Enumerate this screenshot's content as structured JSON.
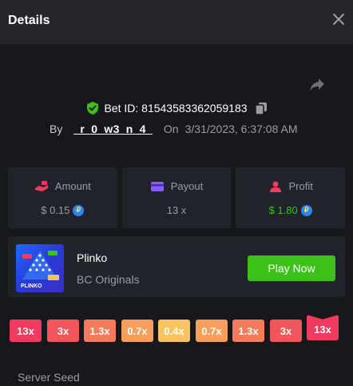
{
  "header": {
    "title": "Details"
  },
  "bet": {
    "id_text": "Bet ID: 81543583362059183",
    "by_label": "By",
    "username": "_r_0_w3_n_4_",
    "on_label": "On",
    "date": "3/31/2023, 6:37:08 AM"
  },
  "stats": {
    "amount": {
      "label": "Amount",
      "value": "$ 0.15"
    },
    "payout": {
      "label": "Payout",
      "value": "13 x"
    },
    "profit": {
      "label": "Profit",
      "value": "$ 1.80"
    }
  },
  "game": {
    "name": "Plinko",
    "provider": "BC Originals",
    "play_label": "Play Now",
    "thumb_text": "PLINKO"
  },
  "multipliers": [
    "13x",
    "3x",
    "1.3x",
    "0.7x",
    "0.4x",
    "0.7x",
    "1.3x",
    "3x",
    "13x"
  ],
  "multiplier_colors": [
    "#f03a5f",
    "#f3565a",
    "#f47a5c",
    "#f79e5c",
    "#f8c360",
    "#f79e5c",
    "#f47a5c",
    "#f3565a",
    "#f03a5f"
  ],
  "winning_slot_index": 8,
  "server_seed_label": "Server Seed",
  "colors": {
    "accent_green": "#3bc117",
    "background": "#17181b",
    "card": "#21232a",
    "header": "#24262b"
  }
}
